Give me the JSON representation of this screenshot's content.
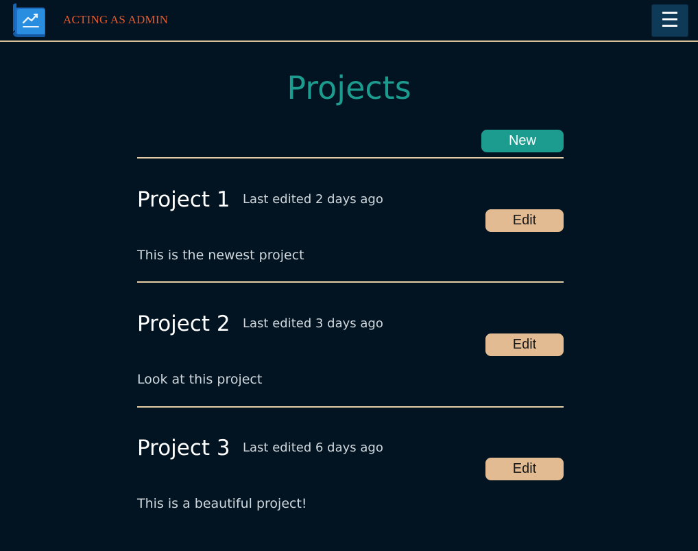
{
  "header": {
    "logo_icon": "chart-scroll-logo-icon",
    "admin_label": "ACTING AS ADMIN",
    "menu_icon": "hamburger-menu-icon",
    "menu_glyph": "☰"
  },
  "main": {
    "title": "Projects",
    "new_button_label": "New",
    "projects": [
      {
        "name": "Project 1",
        "edited": "Last edited 2 days ago",
        "edit_label": "Edit",
        "description": "This is the newest project"
      },
      {
        "name": "Project 2",
        "edited": "Last edited 3 days ago",
        "edit_label": "Edit",
        "description": "Look at this project"
      },
      {
        "name": "Project 3",
        "edited": "Last edited 6 days ago",
        "edit_label": "Edit",
        "description": "This is a beautiful project!"
      }
    ]
  },
  "colors": {
    "background": "#021421",
    "accent": "#1c9c8f",
    "edit_button": "#e2bb93",
    "divider": "#e6cfa6",
    "admin_label": "#e65a2f"
  }
}
